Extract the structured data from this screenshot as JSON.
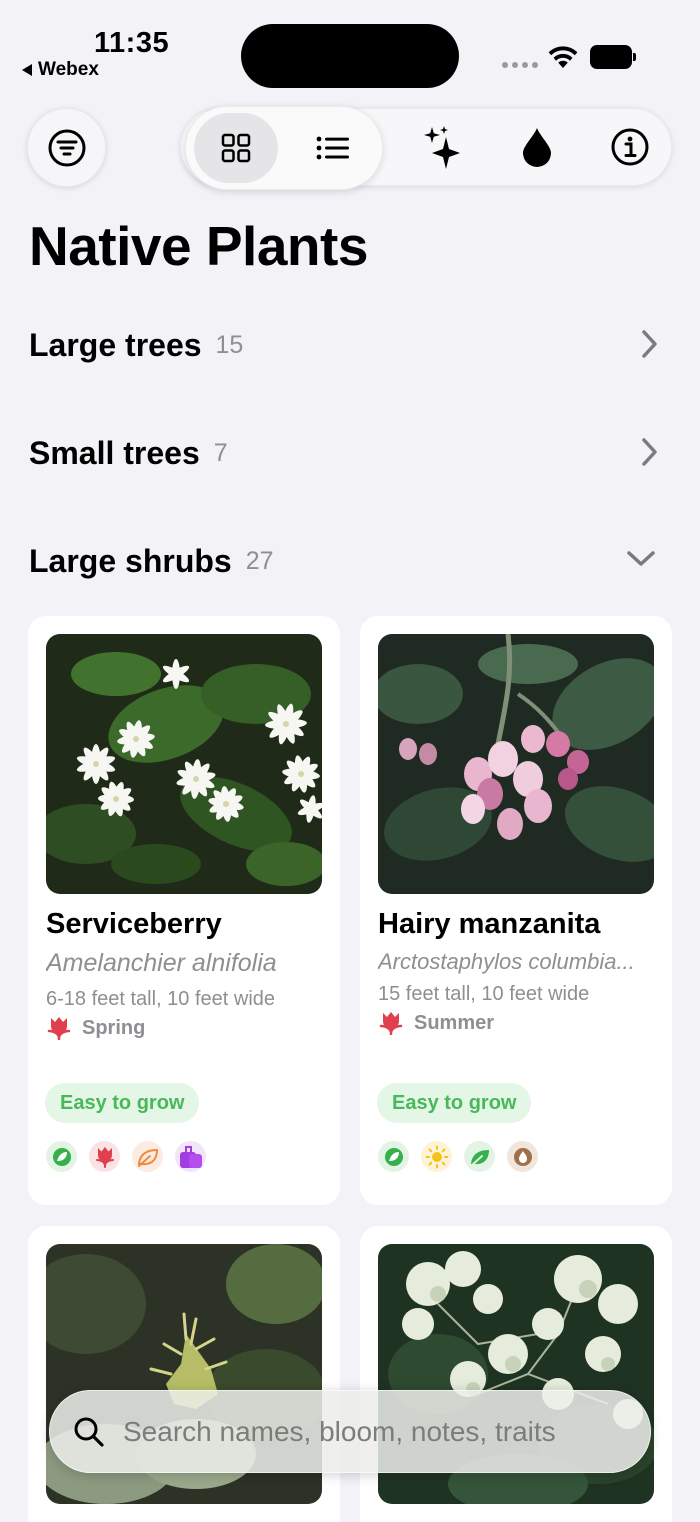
{
  "status_bar": {
    "time": "11:35",
    "back_app": "Webex",
    "icons": [
      "signal-dots",
      "wifi",
      "battery"
    ]
  },
  "toolbar": {
    "filter_icon": "filter-icon",
    "view_modes": [
      {
        "name": "grid-view",
        "icon": "grid-icon",
        "selected": true
      },
      {
        "name": "list-view",
        "icon": "list-icon",
        "selected": false
      }
    ],
    "actions": [
      "sparkles-icon",
      "water-drop-icon",
      "info-icon"
    ]
  },
  "page": {
    "title": "Native Plants"
  },
  "sections": [
    {
      "name": "Large trees",
      "count": "15",
      "expanded": false
    },
    {
      "name": "Small trees",
      "count": "7",
      "expanded": false
    },
    {
      "name": "Large shrubs",
      "count": "27",
      "expanded": true
    }
  ],
  "cards": [
    {
      "name": "Serviceberry",
      "scientific": "Amelanchier alnifolia",
      "size": "6-18 feet tall, 10 feet wide",
      "bloom": "Spring",
      "badge": "Easy to grow",
      "traits": [
        "leaf-icon",
        "flower-icon",
        "leaf-outline-icon",
        "fruit-icon"
      ]
    },
    {
      "name": "Hairy manzanita",
      "scientific": "Arctostaphylos columbia...",
      "size": "15 feet tall, 10 feet wide",
      "bloom": "Summer",
      "badge": "Easy to grow",
      "traits": [
        "leaf-icon",
        "sun-icon",
        "leaf-icon",
        "water-drop-icon"
      ]
    }
  ],
  "search": {
    "placeholder": "Search names, bloom, notes, traits",
    "value": ""
  },
  "colors": {
    "background": "#f2f2f7",
    "badge_bg": "#e4f6e6",
    "badge_text": "#49b85a",
    "bloom_icon": "#e0404e",
    "muted_text": "#8e8e93"
  }
}
